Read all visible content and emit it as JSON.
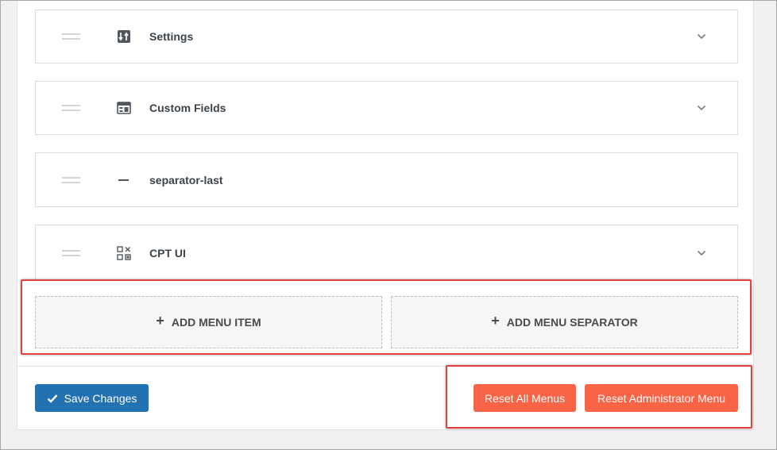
{
  "menu_items": [
    {
      "label": "Settings",
      "icon": "settings-sliders-icon",
      "expandable": true
    },
    {
      "label": "Custom Fields",
      "icon": "table-fields-icon",
      "expandable": true
    },
    {
      "label": "separator-last",
      "icon": "separator-dash-icon",
      "expandable": false
    },
    {
      "label": "CPT UI",
      "icon": "grid-cptui-icon",
      "expandable": true
    }
  ],
  "actions": {
    "add_menu_item": "ADD MENU ITEM",
    "add_menu_separator": "ADD MENU SEPARATOR",
    "save_changes": "Save Changes",
    "reset_all_menus": "Reset All Menus",
    "reset_administrator_menu": "Reset Administrator Menu"
  },
  "colors": {
    "primary": "#2271b1",
    "reset": "#f96446",
    "highlight": "#e04040"
  }
}
